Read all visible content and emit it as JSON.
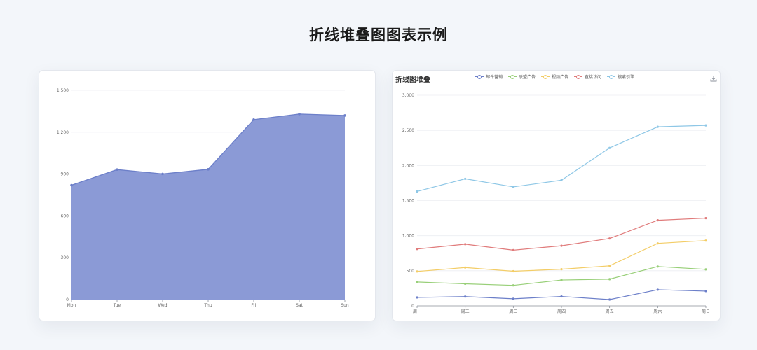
{
  "page": {
    "title": "折线堆叠图图表示例"
  },
  "colors": {
    "area_fill": "#8b9ad6",
    "area_line": "#6c7fc9",
    "grid": "#eceef2",
    "axis": "#8a8f99"
  },
  "chart_data": [
    {
      "type": "area",
      "categories": [
        "Mon",
        "Tue",
        "Wed",
        "Thu",
        "Fri",
        "Sat",
        "Sun"
      ],
      "values": [
        820,
        932,
        901,
        934,
        1290,
        1330,
        1320
      ],
      "ylim": [
        0,
        1500
      ],
      "yticks": [
        0,
        300,
        600,
        900,
        1200,
        1500
      ],
      "ytick_labels": [
        "0",
        "300",
        "600",
        "900",
        "1,200",
        "1,500"
      ],
      "grid": true
    },
    {
      "type": "line",
      "title": "折线图堆叠",
      "categories": [
        "周一",
        "周二",
        "周三",
        "周四",
        "周五",
        "周六",
        "周日"
      ],
      "ylim": [
        0,
        3000
      ],
      "yticks": [
        0,
        500,
        1000,
        1500,
        2000,
        2500,
        3000
      ],
      "ytick_labels": [
        "0",
        "500",
        "1,000",
        "1,500",
        "2,000",
        "2,500",
        "3,000"
      ],
      "grid": true,
      "stacked": true,
      "legend_position": "top-center",
      "series": [
        {
          "name": "邮件营销",
          "color": "#6c7fc9",
          "values": [
            120,
            132,
            101,
            134,
            90,
            230,
            210
          ]
        },
        {
          "name": "联盟广告",
          "color": "#98cf78",
          "values": [
            220,
            182,
            191,
            234,
            290,
            330,
            310
          ]
        },
        {
          "name": "视频广告",
          "color": "#f3cd67",
          "values": [
            150,
            232,
            201,
            154,
            190,
            330,
            410
          ]
        },
        {
          "name": "直接访问",
          "color": "#e07b7b",
          "values": [
            320,
            332,
            301,
            334,
            390,
            330,
            320
          ]
        },
        {
          "name": "搜索引擎",
          "color": "#8ec7e6",
          "values": [
            820,
            932,
            901,
            934,
            1290,
            1330,
            1320
          ]
        }
      ]
    }
  ],
  "icons": {
    "download": "download-icon"
  }
}
